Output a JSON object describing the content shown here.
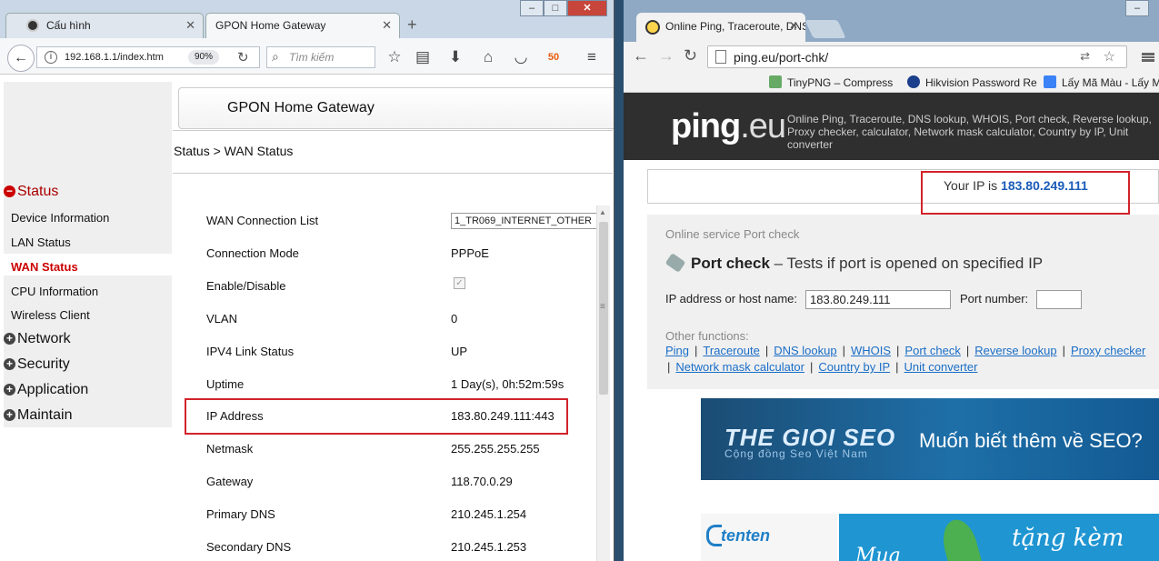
{
  "left_window": {
    "tabs": [
      {
        "label": "Cấu hình"
      },
      {
        "label": "GPON Home Gateway",
        "active": true
      }
    ],
    "url": "192.168.1.1/index.htm",
    "zoom": "90%",
    "search_placeholder": "Tìm kiếm",
    "brand_badge": "50",
    "gateway_title": "GPON Home Gateway",
    "breadcrumb": "Status > WAN Status",
    "sidebar": {
      "sections": [
        "Status",
        "Network",
        "Security",
        "Application",
        "Maintain"
      ],
      "status_items": [
        "Device Information",
        "LAN Status",
        "WAN Status",
        "CPU Information",
        "Wireless Client"
      ]
    },
    "rows": [
      {
        "label": "WAN Connection List",
        "value": "1_TR069_INTERNET_OTHER"
      },
      {
        "label": "Connection Mode",
        "value": "PPPoE"
      },
      {
        "label": "Enable/Disable",
        "value": "",
        "checked": true
      },
      {
        "label": "VLAN",
        "value": "0"
      },
      {
        "label": "IPV4 Link Status",
        "value": "UP"
      },
      {
        "label": "Uptime",
        "value": "1 Day(s), 0h:52m:59s"
      },
      {
        "label": "IP Address",
        "value": "183.80.249.111:443"
      },
      {
        "label": "Netmask",
        "value": "255.255.255.255"
      },
      {
        "label": "Gateway",
        "value": "118.70.0.29"
      },
      {
        "label": "Primary DNS",
        "value": "210.245.1.254"
      },
      {
        "label": "Secondary DNS",
        "value": "210.245.1.253"
      }
    ]
  },
  "right_window": {
    "tab_title": "Online Ping, Traceroute, DNS lookup",
    "url": "ping.eu/port-chk/",
    "bookmarks": [
      "TinyPNG – Compress",
      "Hikvision Password Re",
      "Lấy Mã Màu - Lấy M"
    ],
    "logo_main": "ping",
    "logo_suffix": ".eu",
    "description": "Online Ping, Traceroute, DNS lookup, WHOIS, Port check, Reverse lookup, Proxy checker, calculator, Network mask calculator, Country by IP, Unit converter",
    "your_ip_label": "Your IP is",
    "your_ip": "183.80.249.111",
    "service_label": "Online service Port check",
    "heading_bold": "Port check",
    "heading_rest": " – Tests if port is opened on specified IP",
    "host_label": "IP address or host name:",
    "host_value": "183.80.249.111",
    "port_label": "Port number:",
    "port_value": "",
    "other_functions_label": "Other functions:",
    "links_row1": [
      "Ping",
      "Traceroute",
      "DNS lookup",
      "WHOIS",
      "Port check",
      "Reverse lookup",
      "Proxy checker"
    ],
    "links_row2": [
      "Network mask calculator",
      "Country by IP",
      "Unit converter"
    ],
    "ad1": {
      "logo": "THE GIOI SEO",
      "tagline": "Cộng đồng Seo Việt Nam",
      "message": "Muốn biết thêm về SEO?"
    },
    "ad2": {
      "logo": "tenten",
      "text1": "tặng kèm",
      "text2": "Mua"
    }
  },
  "colors": {
    "highlight": "#d2232a",
    "link": "#1a6ec7",
    "ip": "#1a5bb8",
    "status_red": "#c00000"
  }
}
